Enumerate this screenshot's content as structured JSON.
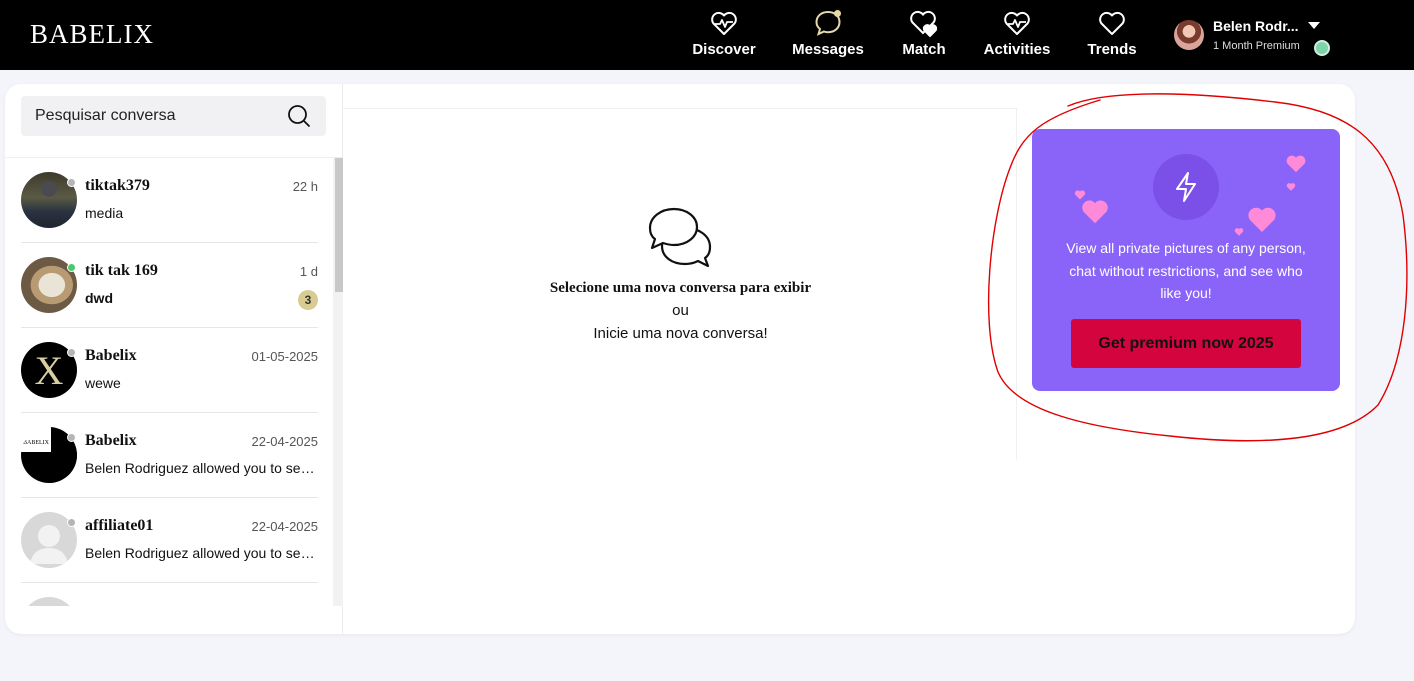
{
  "app": {
    "logo": "BABELIX"
  },
  "nav": {
    "items": [
      {
        "label": "Discover",
        "icon": "heart-pulse-icon"
      },
      {
        "label": "Messages",
        "icon": "chat-bubble-icon"
      },
      {
        "label": "Match",
        "icon": "double-heart-icon"
      },
      {
        "label": "Activities",
        "icon": "heart-pulse-icon"
      },
      {
        "label": "Trends",
        "icon": "heart-outline-icon"
      }
    ]
  },
  "user": {
    "name": "Belen Rodr...",
    "plan": "1 Month Premium"
  },
  "search": {
    "placeholder": "Pesquisar conversa"
  },
  "conversations": [
    {
      "name": "tiktak379",
      "time": "22 h",
      "preview": "media",
      "status": "offline",
      "avatar": "photo"
    },
    {
      "name": "tik tak 169",
      "time": "1 d",
      "preview": "dwd",
      "status": "online",
      "avatar": "photo",
      "unread": "3"
    },
    {
      "name": "Babelix",
      "time": "01-05-2025",
      "preview": "wewe",
      "status": "offline",
      "avatar": "logo-x"
    },
    {
      "name": "Babelix",
      "time": "22-04-2025",
      "preview": "Belen Rodriguez allowed you to see...",
      "status": "offline",
      "avatar": "logo-babelix",
      "avatar_text": "BABELIX"
    },
    {
      "name": "affiliate01",
      "time": "22-04-2025",
      "preview": "Belen Rodriguez allowed you to see...",
      "status": "offline",
      "avatar": "placeholder"
    }
  ],
  "empty_state": {
    "title": "Selecione uma nova conversa para exibir",
    "or": "ou",
    "cta": "Inicie uma nova conversa!"
  },
  "premium": {
    "description": "View all private pictures of any person, chat without restrictions, and see who like you!",
    "button_label": "Get premium now 2025"
  },
  "colors": {
    "topbar": "#000000",
    "premium_card": "#8a64f8",
    "premium_button": "#d4053e",
    "online": "#4cc76f",
    "offline": "#b5b5b5",
    "annotation": "#e00000"
  }
}
